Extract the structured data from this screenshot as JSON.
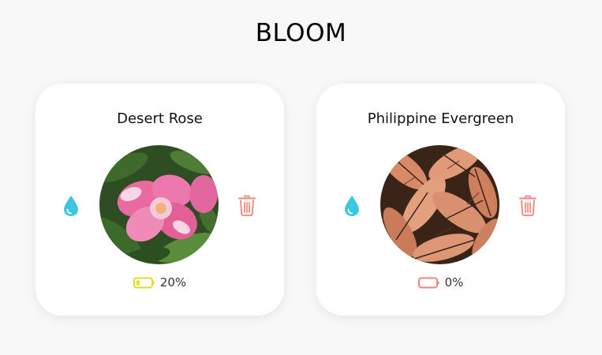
{
  "app": {
    "title": "BLOOM"
  },
  "colors": {
    "water": "#3cc6df",
    "delete": "#f0837a",
    "battery_low": "#dede1a",
    "battery_empty": "#f0837a"
  },
  "plants": [
    {
      "name": "Desert Rose",
      "image": "pink-flower-photo",
      "water_icon": "water-drop-icon",
      "delete_icon": "trash-icon",
      "battery_icon": "battery-low-icon",
      "battery_level": 0.2,
      "battery_text": "20%"
    },
    {
      "name": "Philippine Evergreen",
      "image": "orange-leaves-photo",
      "water_icon": "water-drop-icon",
      "delete_icon": "trash-icon",
      "battery_icon": "battery-empty-icon",
      "battery_level": 0,
      "battery_text": "0%"
    }
  ]
}
